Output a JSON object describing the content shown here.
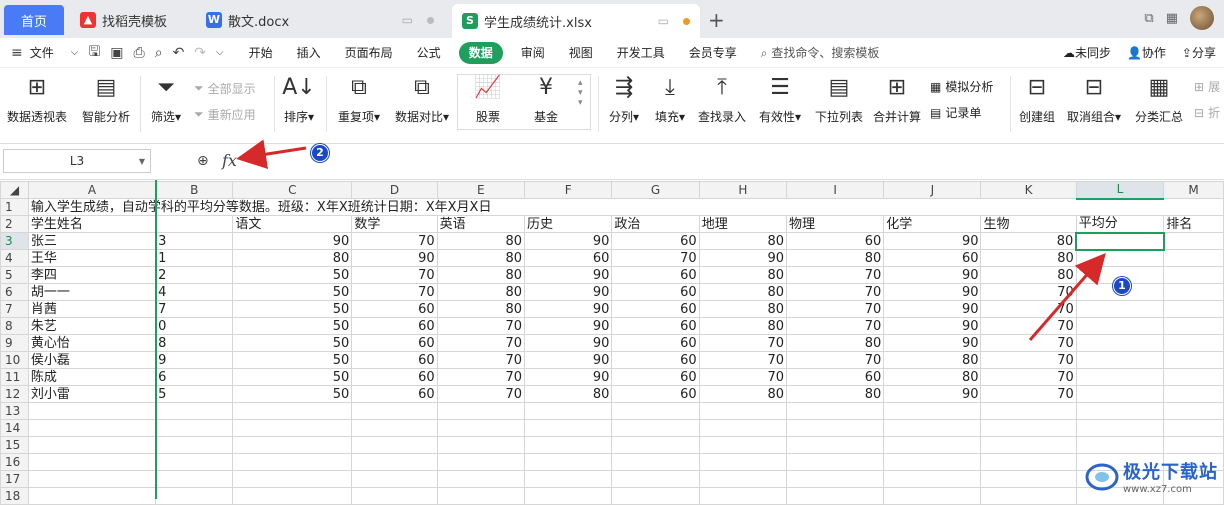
{
  "tabs": {
    "home": "首页",
    "t1": "找稻壳模板",
    "t2": "散文.docx",
    "t3": "学生成绩统计.xlsx"
  },
  "menu": {
    "file": "文件",
    "items": [
      "开始",
      "插入",
      "页面布局",
      "公式",
      "数据",
      "审阅",
      "视图",
      "开发工具",
      "会员专享"
    ],
    "active": "数据",
    "search": "查找命令、搜索模板",
    "sync": "未同步",
    "collab": "协作",
    "share": "分享"
  },
  "ribbon": {
    "pivot": "数据透视表",
    "smart": "智能分析",
    "filter": "筛选",
    "show_all": "全部显示",
    "reapply": "重新应用",
    "sort": "排序",
    "dup": "重复项",
    "compare": "数据对比",
    "stock": "股票",
    "fund": "基金",
    "split": "分列",
    "fill": "填充",
    "lookup": "查找录入",
    "valid": "有效性",
    "dropdown": "下拉列表",
    "merge": "合并计算",
    "simulate": "模拟分析",
    "record": "记录单",
    "group": "创建组",
    "ungroup": "取消组合",
    "subtotal": "分类汇总",
    "expand": "展",
    "collapse": "折"
  },
  "formula": {
    "cell_ref": "L3",
    "fx": "fx",
    "value": ""
  },
  "sheet": {
    "columns": [
      "A",
      "B",
      "C",
      "D",
      "E",
      "F",
      "G",
      "H",
      "I",
      "J",
      "K",
      "L",
      "M"
    ],
    "selected_col": "L",
    "selected_row": 3,
    "row1": "输入学生成绩，自动学科的平均分等数据。班级：X年X班统计日期：X年X月X日",
    "header": [
      "学生姓名",
      "",
      "语文",
      "数学",
      "英语",
      "历史",
      "政治",
      "地理",
      "物理",
      "化学",
      "生物",
      "平均分",
      "排名"
    ],
    "rows": [
      [
        "张三",
        "3",
        "90",
        "70",
        "80",
        "90",
        "60",
        "80",
        "60",
        "90",
        "80"
      ],
      [
        "王华",
        "1",
        "80",
        "90",
        "80",
        "60",
        "70",
        "90",
        "80",
        "60",
        "80"
      ],
      [
        "李四",
        "2",
        "50",
        "70",
        "80",
        "90",
        "60",
        "80",
        "70",
        "90",
        "80"
      ],
      [
        "胡一一",
        "4",
        "50",
        "70",
        "80",
        "90",
        "60",
        "80",
        "70",
        "90",
        "70"
      ],
      [
        "肖茜",
        "7",
        "50",
        "60",
        "80",
        "90",
        "60",
        "80",
        "70",
        "90",
        "70"
      ],
      [
        "朱艺",
        "0",
        "50",
        "60",
        "70",
        "90",
        "60",
        "80",
        "70",
        "90",
        "70"
      ],
      [
        "黄心怡",
        "8",
        "50",
        "60",
        "70",
        "90",
        "60",
        "70",
        "80",
        "90",
        "70"
      ],
      [
        "侯小磊",
        "9",
        "50",
        "60",
        "70",
        "90",
        "60",
        "70",
        "70",
        "80",
        "70"
      ],
      [
        "陈成",
        "6",
        "50",
        "60",
        "70",
        "90",
        "60",
        "70",
        "60",
        "80",
        "70"
      ],
      [
        "刘小雷",
        "5",
        "50",
        "60",
        "70",
        "80",
        "60",
        "80",
        "80",
        "90",
        "70"
      ]
    ],
    "row_numbers": [
      1,
      2,
      3,
      4,
      5,
      6,
      7,
      8,
      9,
      10,
      11,
      12,
      13,
      14,
      15,
      16,
      17,
      18
    ]
  },
  "annotations": {
    "badge1": "1",
    "badge2": "2",
    "arrow_color": "#d62a2a"
  },
  "watermark": {
    "text": "极光下载站",
    "url": "www.xz7.com"
  },
  "colors": {
    "accent_green": "#1e9e5a",
    "home_tab": "#4a7bf7",
    "badge": "#1b47c9"
  }
}
